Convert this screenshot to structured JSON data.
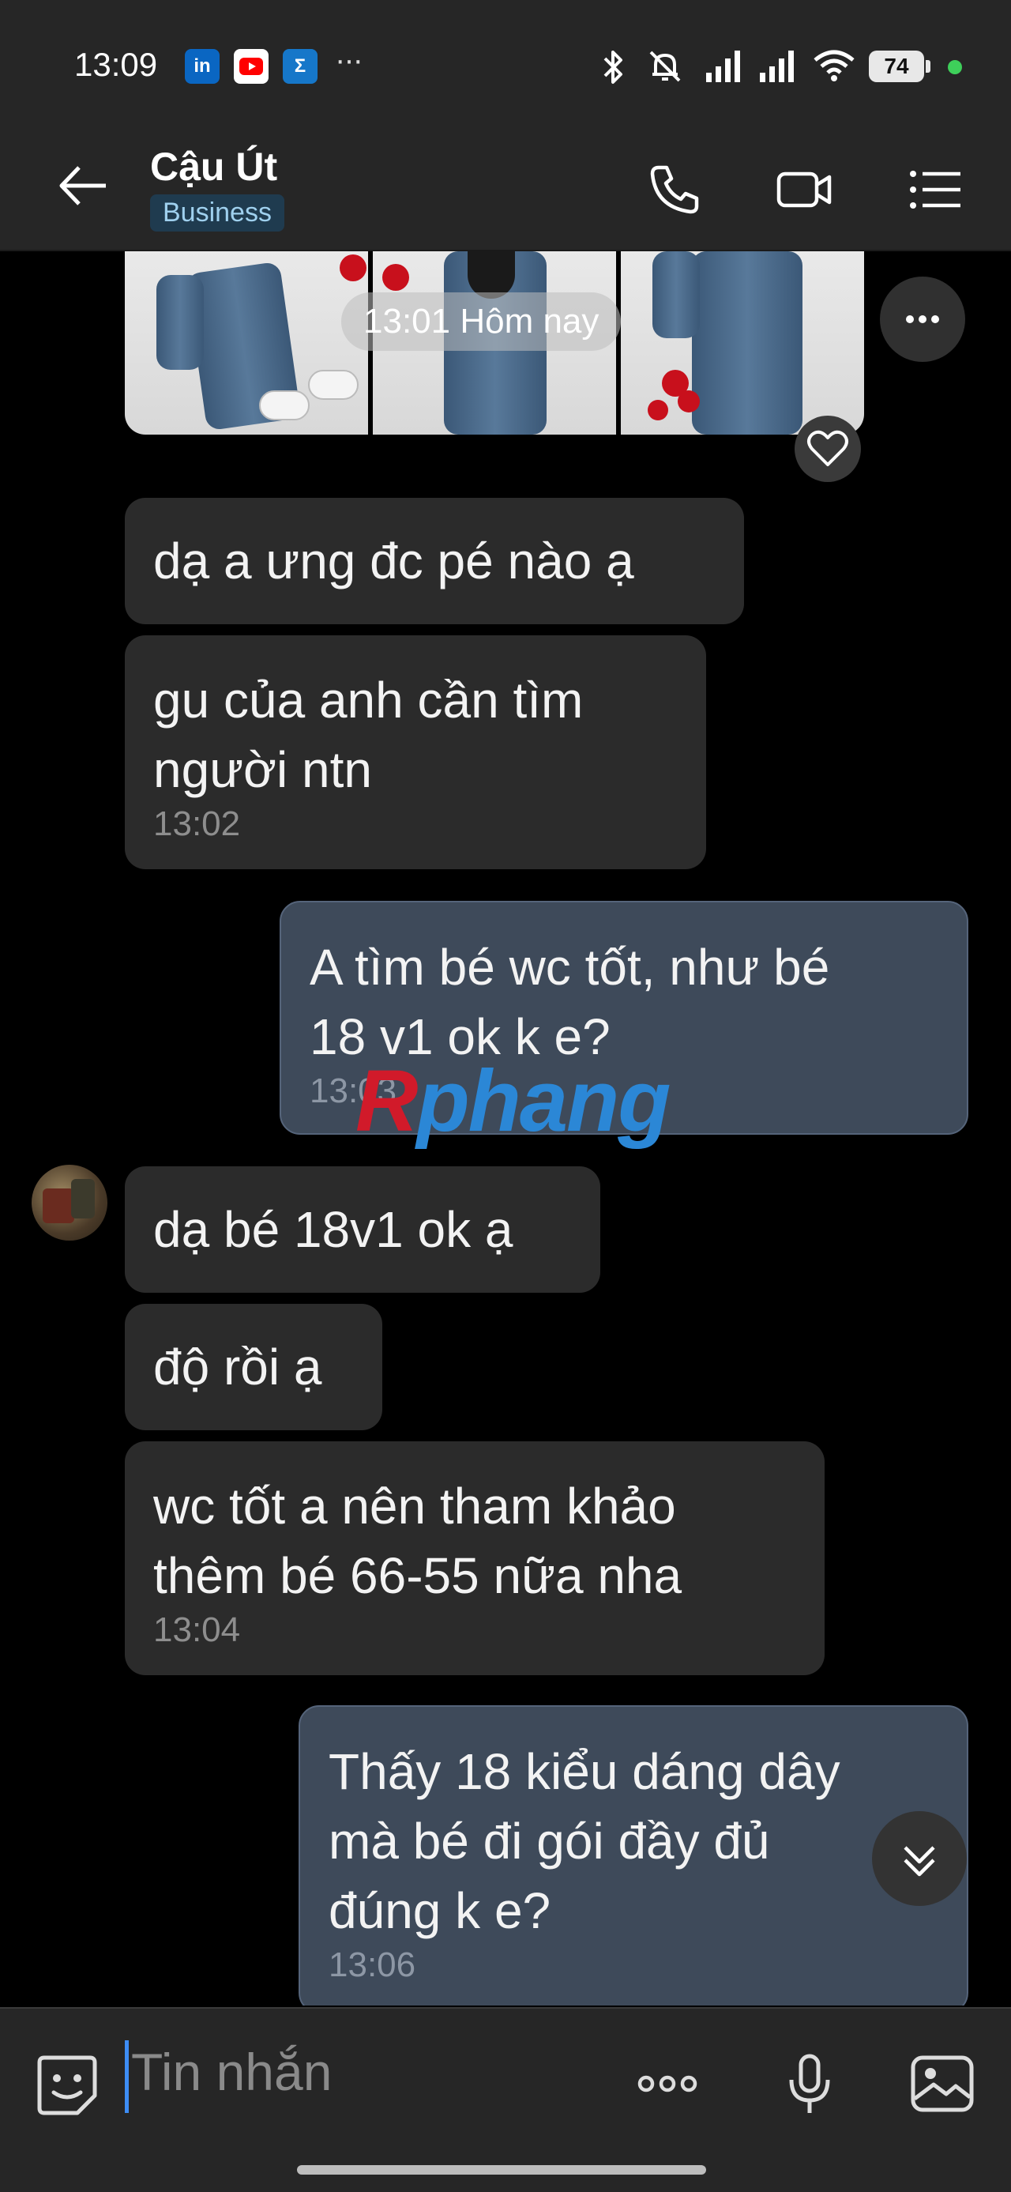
{
  "status_bar": {
    "time": "13:09",
    "battery": "74",
    "apps": [
      {
        "name": "linkedin-icon",
        "label": "in",
        "color": "#0a66c2"
      },
      {
        "name": "youtube-icon",
        "label": "▶",
        "color": "#ff0000"
      },
      {
        "name": "sigma-app-icon",
        "label": "Σ",
        "color": "#1677c9"
      }
    ],
    "more": "···"
  },
  "header": {
    "contact_name": "Cậu Út",
    "badge": "Business"
  },
  "chat": {
    "photo_time": "13:01 Hôm nay",
    "messages": [
      {
        "dir": "in",
        "text": "dạ a ưng đc pé nào ạ",
        "time": ""
      },
      {
        "dir": "in",
        "text": "gu của anh cần tìm\nngười ntn",
        "time": "13:02"
      },
      {
        "dir": "out",
        "text": "A tìm bé wc tốt, như bé\n18 v1 ok k e?",
        "time": "13:03"
      },
      {
        "dir": "in",
        "text": "dạ bé 18v1 ok ạ",
        "time": ""
      },
      {
        "dir": "in",
        "text": "độ rồi ạ",
        "time": ""
      },
      {
        "dir": "in",
        "text": "wc tốt a nên tham khảo\nthêm bé 66-55 nữa nha",
        "time": "13:04"
      },
      {
        "dir": "out",
        "text": "Thấy 18 kiểu dáng dây\nmà bé đi gói đầy đủ\nđúng k e?",
        "time": "13:06"
      }
    ],
    "watermark": {
      "part1": "R",
      "part2": "phang"
    }
  },
  "input": {
    "placeholder": "Tin nhắn"
  },
  "colors": {
    "incoming_bubble": "#2b2b2b",
    "outgoing_bubble": "#3e4a5a",
    "accent": "#3d8df5"
  }
}
